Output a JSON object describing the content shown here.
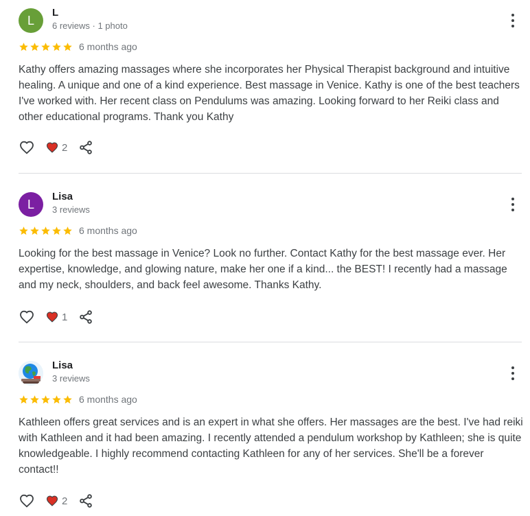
{
  "colors": {
    "star": "#fbbc04",
    "heart": "#d93025",
    "text": "#3c4043",
    "meta": "#70757a"
  },
  "icons": {
    "star": "star-icon",
    "like": "heart-outline-icon",
    "love": "heart-filled-icon",
    "share": "share-icon",
    "more": "more-vertical-icon"
  },
  "reviews": [
    {
      "avatar_letter": "L",
      "avatar_color": "#689f38",
      "name": "L",
      "meta": "6 reviews · 1 photo",
      "rating": 5,
      "time_ago": "6 months ago",
      "text": "Kathy offers amazing massages where she incorporates her Physical Therapist background and intuitive healing. A unique and one of a kind experience. Best massage in Venice. Kathy is one of the best teachers I've worked with. Her recent class on Pendulums was amazing. Looking forward to her Reiki class and other educational programs. Thank you Kathy",
      "love_count": "2"
    },
    {
      "avatar_letter": "L",
      "avatar_color": "#7b1fa2",
      "name": "Lisa",
      "meta": "3 reviews",
      "rating": 5,
      "time_ago": "6 months ago",
      "text": "Looking for the best massage in Venice? Look no further. Contact Kathy for the best massage ever. Her expertise, knowledge, and glowing nature, make her one if a kind... the BEST! I recently had a massage and my neck, shoulders, and back feel awesome. Thanks Kathy.",
      "love_count": "1"
    },
    {
      "avatar_letter": "",
      "avatar_color": "",
      "name": "Lisa",
      "meta": "3 reviews",
      "rating": 5,
      "time_ago": "6 months ago",
      "text": "Kathleen offers great services and is an expert in what she offers. Her massages are the best. I've had reiki with Kathleen and it had been amazing. I recently attended a pendulum workshop by Kathleen; she is quite knowledgeable. I highly recommend contacting Kathleen for any of her services. She'll be a forever contact!!",
      "love_count": "2"
    }
  ]
}
